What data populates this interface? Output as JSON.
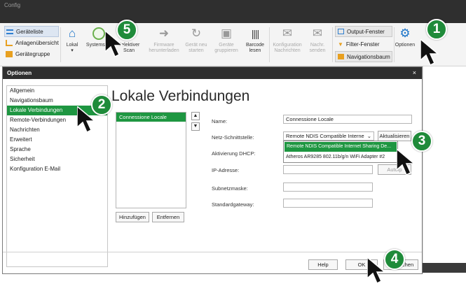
{
  "window": {
    "title": "Config"
  },
  "ribbon": {
    "left_tree": [
      {
        "label": "Geräteliste",
        "icon": "list-icon",
        "selected": true
      },
      {
        "label": "Anlagenübersicht",
        "icon": "tree-icon",
        "selected": false
      },
      {
        "label": "Gerätegruppe",
        "icon": "group-icon",
        "selected": false
      }
    ],
    "buttons": [
      {
        "label1": "Lokal",
        "label2": "▾",
        "icon": "home-icon",
        "enabled": true
      },
      {
        "label1": "Systemsc...",
        "label2": "",
        "icon": "network-scan-icon",
        "enabled": true
      },
      {
        "label1": "Selektiver",
        "label2": "Scan",
        "icon": "selective-scan-icon",
        "enabled": true
      },
      {
        "label1": "Firmware",
        "label2": "herunterladen",
        "icon": "arrow-right-icon",
        "enabled": false
      },
      {
        "label1": "Gerät neu",
        "label2": "starten",
        "icon": "restart-icon",
        "enabled": false
      },
      {
        "label1": "Geräte",
        "label2": "gruppieren",
        "icon": "group-devices-icon",
        "enabled": false
      },
      {
        "label1": "Barcode",
        "label2": "lesen",
        "icon": "barcode-icon",
        "enabled": true
      },
      {
        "label1": "Konfiguration",
        "label2": "Nachrichten",
        "icon": "config-message-icon",
        "enabled": false
      },
      {
        "label1": "Nachr.",
        "label2": "senden",
        "icon": "mail-icon",
        "enabled": false
      }
    ],
    "right_panel": [
      {
        "label": "Output-Fenster",
        "icon": "window-icon",
        "selected": true
      },
      {
        "label": "Filter-Fenster",
        "icon": "filter-icon",
        "selected": false
      },
      {
        "label": "Navigationsbaum",
        "icon": "navtree-icon",
        "selected": true
      }
    ],
    "options_label": "Optionen"
  },
  "dialog": {
    "title": "Optionen",
    "close": "×",
    "nav_items": [
      "Allgemein",
      "Navigationsbaum",
      "Lokale Verbindungen",
      "Remote-Verbindungen",
      "Nachrichten",
      "Erweitert",
      "Sprache",
      "Sicherheit",
      "Konfiguration E-Mail"
    ],
    "nav_selected_index": 2,
    "page_title": "Lokale Verbindungen",
    "connections": [
      "Connessione Locale"
    ],
    "up_arrow": "▲",
    "down_arrow": "▼",
    "add_button": "Hinzufügen",
    "remove_button": "Entfernen",
    "fields": {
      "name_label": "Name:",
      "name_value": "Connessione Locale",
      "interface_label": "Netz-Schnittstelle:",
      "interface_value": "Remote NDIS Compatible Interne",
      "refresh_button": "Aktualisieren",
      "dhcp_label": "Aktivierung DHCP:",
      "ip_label": "IP-Adresse:",
      "autoip_button": "Autoip",
      "subnet_label": "Subnetzmaske:",
      "gateway_label": "Standardgateway:"
    },
    "dropdown_options": [
      "Remote NDIS Compatible Internet Sharing De...",
      "Atheros AR9285 802.11b/g/n WiFi Adapter #2"
    ],
    "help_button": "Help",
    "ok_button": "OK",
    "cancel_button": "Abbrechen"
  },
  "annotations": [
    "1",
    "2",
    "3",
    "4",
    "5"
  ],
  "colors": {
    "accent_green": "#1e9641",
    "badge_green": "#1f8b3a",
    "title_dark": "#2e2e2e",
    "icon_blue": "#1a73c8"
  }
}
